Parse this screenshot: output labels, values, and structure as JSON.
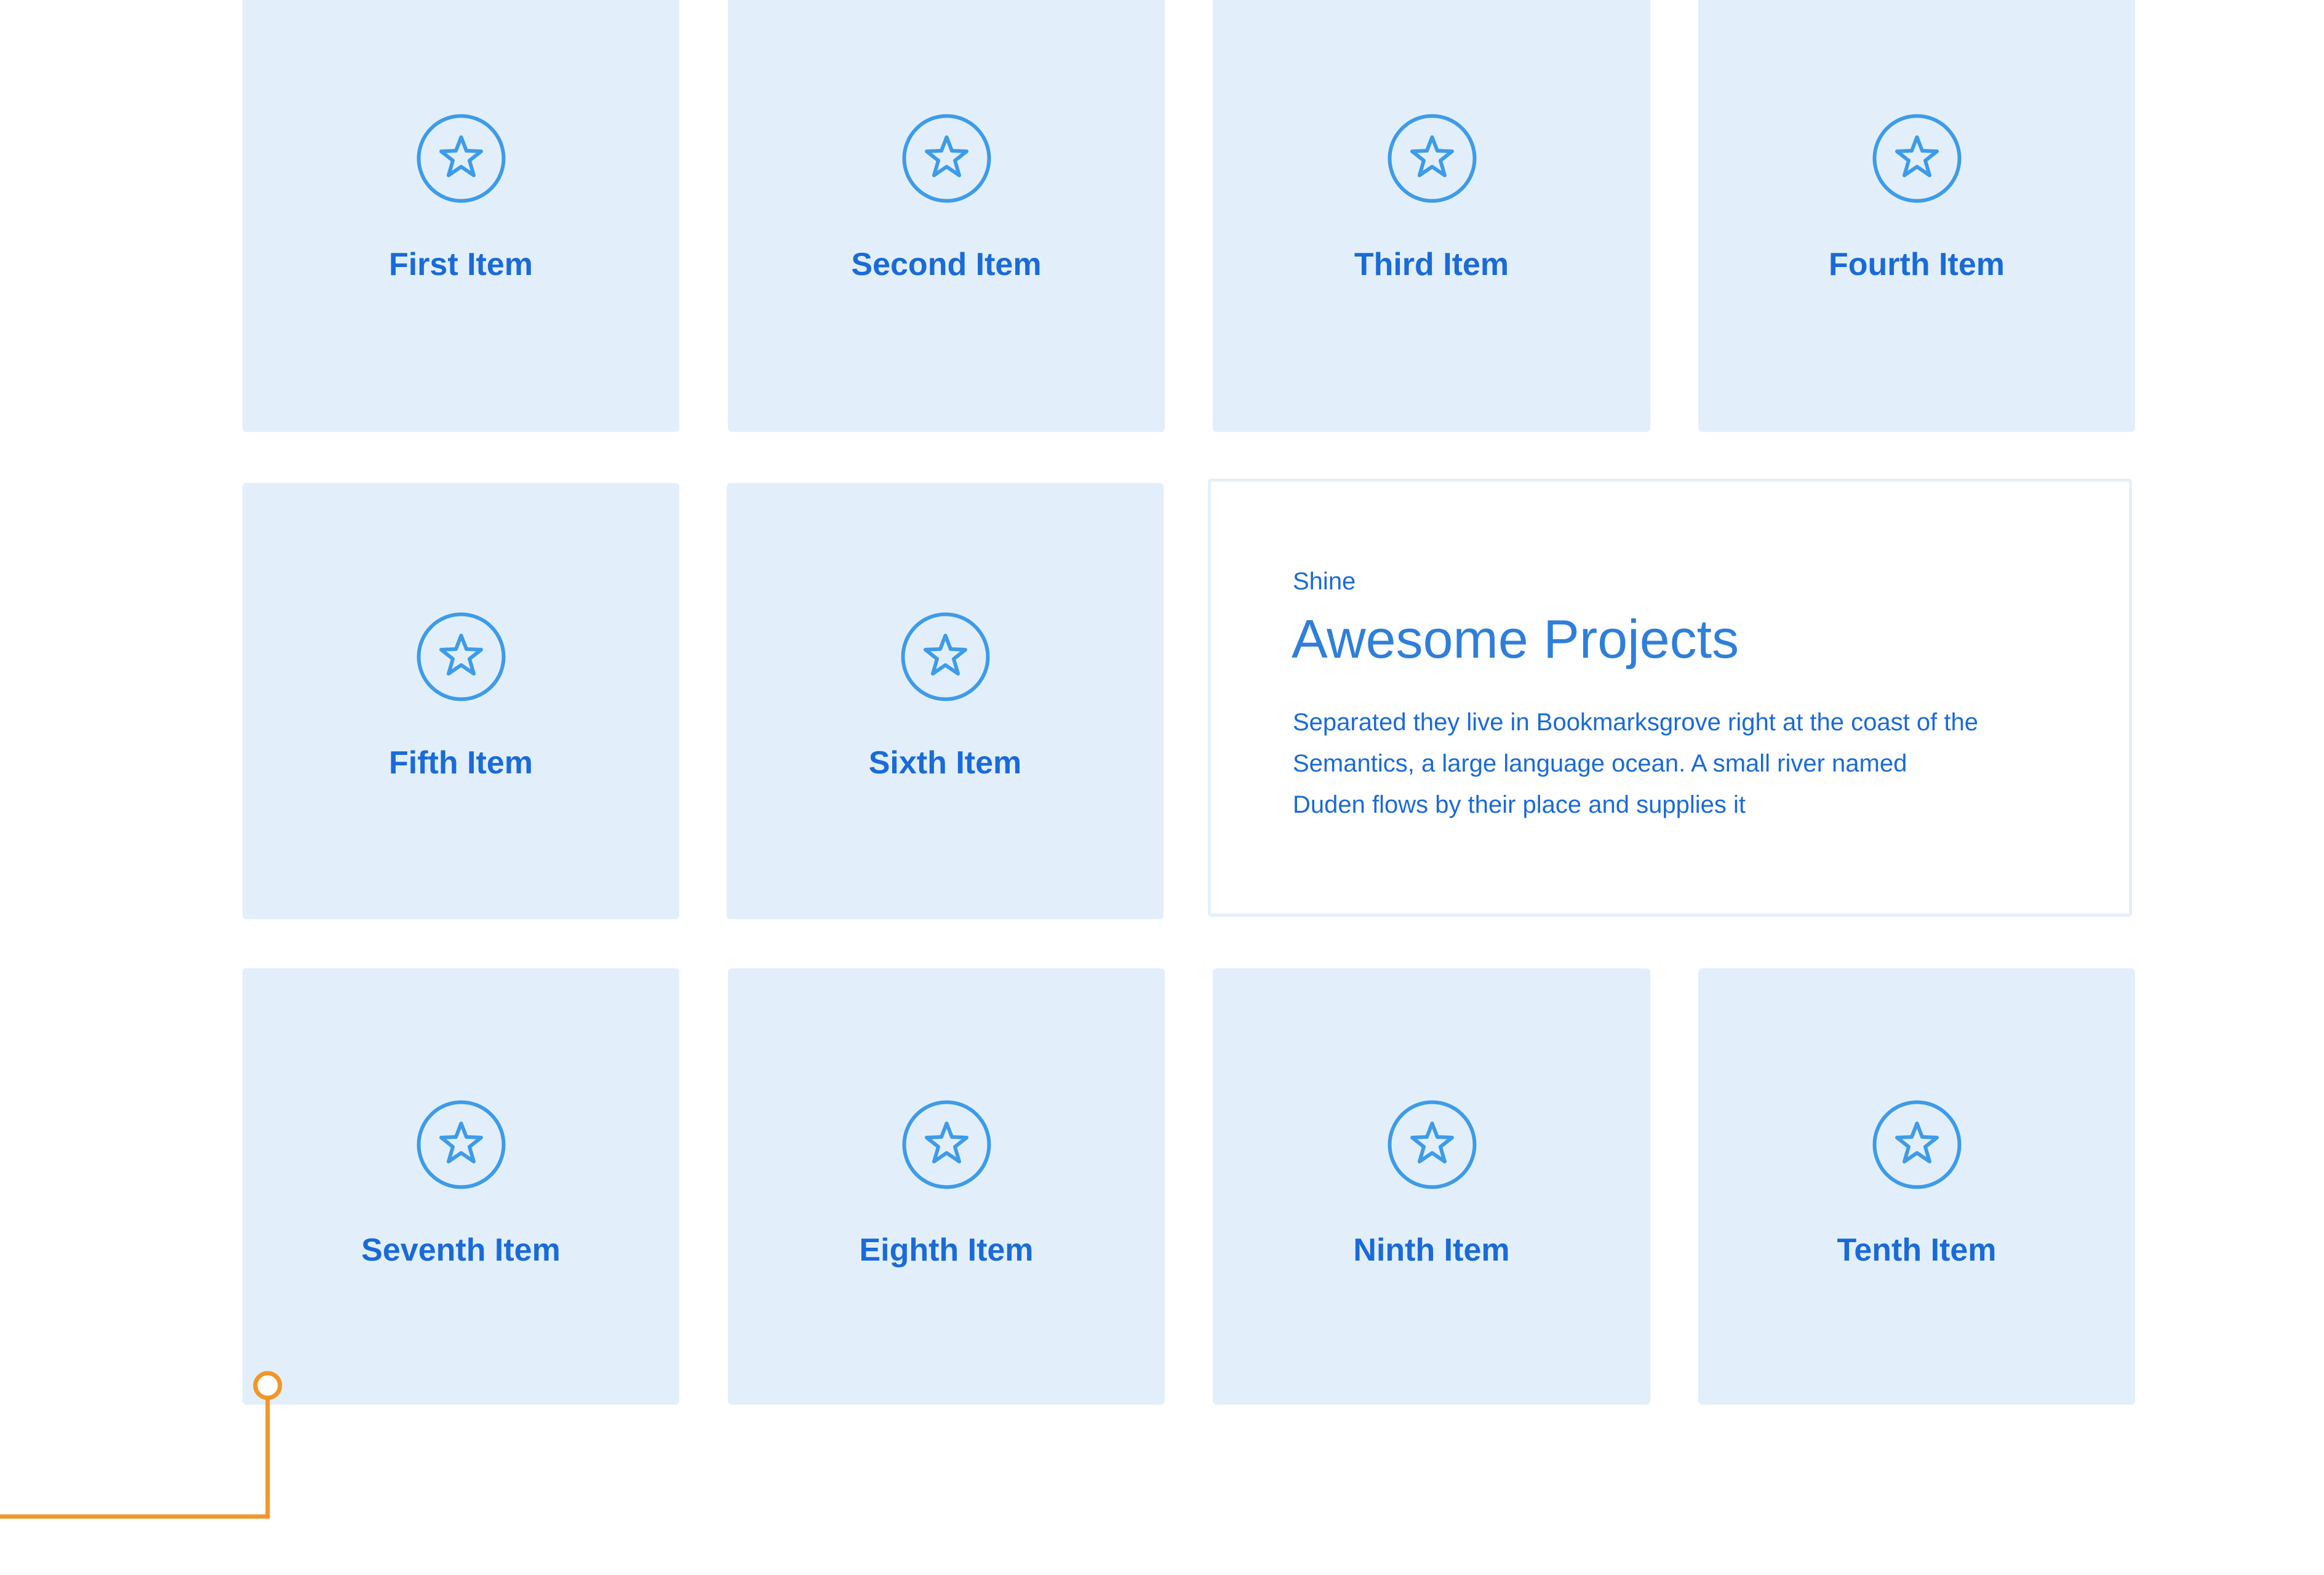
{
  "colors": {
    "card_background": "#e2effa",
    "accent_blue": "#1a6ad8",
    "icon_blue": "#3d9be9",
    "connector_orange": "#f0962a"
  },
  "grid": {
    "items": [
      {
        "label": "First Item",
        "icon": "star-icon"
      },
      {
        "label": "Second Item",
        "icon": "star-icon"
      },
      {
        "label": "Third Item",
        "icon": "star-icon"
      },
      {
        "label": "Fourth Item",
        "icon": "star-icon"
      },
      {
        "label": "Fifth Item",
        "icon": "star-icon"
      },
      {
        "label": "Sixth Item",
        "icon": "star-icon"
      },
      {
        "label": "Seventh Item",
        "icon": "star-icon"
      },
      {
        "label": "Eighth Item",
        "icon": "star-icon"
      },
      {
        "label": "Ninth Item",
        "icon": "star-icon"
      },
      {
        "label": "Tenth Item",
        "icon": "star-icon"
      }
    ]
  },
  "feature": {
    "eyebrow": "Shine",
    "title": "Awesome Projects",
    "description": "Separated they live in Bookmarksgrove right at the coast of the Semantics, a large language ocean. A small river named Duden flows by their place and supplies it"
  }
}
